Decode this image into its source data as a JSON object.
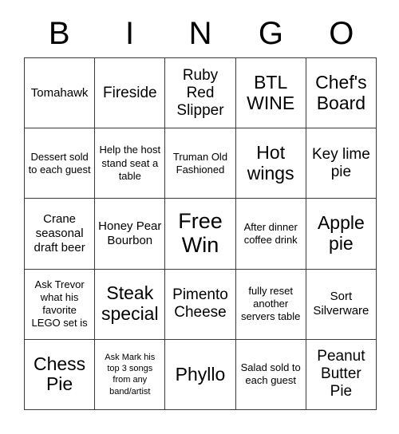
{
  "card": {
    "header_letters": [
      "B",
      "I",
      "N",
      "G",
      "O"
    ],
    "columns": 5,
    "rows": 5,
    "border_color": "#3a3a3a",
    "background_color": "#ffffff",
    "text_color": "#000000",
    "free_space": {
      "row": 2,
      "column": 2,
      "label": "Free Win"
    },
    "cells": [
      {
        "text": "Tomahawk",
        "size": "fs-m"
      },
      {
        "text": "Fireside",
        "size": "fs-l"
      },
      {
        "text": "Ruby Red Slipper",
        "size": "fs-l"
      },
      {
        "text": "BTL WINE",
        "size": "fs-xl"
      },
      {
        "text": "Chef's Board",
        "size": "fs-xl"
      },
      {
        "text": "Dessert sold to each guest",
        "size": "fs-s"
      },
      {
        "text": "Help the host stand seat a table",
        "size": "fs-s"
      },
      {
        "text": "Truman Old Fashioned",
        "size": "fs-s"
      },
      {
        "text": "Hot wings",
        "size": "fs-xl"
      },
      {
        "text": "Key lime pie",
        "size": "fs-l"
      },
      {
        "text": "Crane seasonal draft beer",
        "size": "fs-m"
      },
      {
        "text": "Honey Pear Bourbon",
        "size": "fs-m"
      },
      {
        "text": "Free Win",
        "size": "fs-xxl"
      },
      {
        "text": "After dinner coffee drink",
        "size": "fs-s"
      },
      {
        "text": "Apple pie",
        "size": "fs-xl"
      },
      {
        "text": "Ask Trevor what his favorite LEGO set is",
        "size": "fs-s"
      },
      {
        "text": "Steak special",
        "size": "fs-xl"
      },
      {
        "text": "Pimento Cheese",
        "size": "fs-l"
      },
      {
        "text": "fully reset another servers table",
        "size": "fs-s"
      },
      {
        "text": "Sort Silverware",
        "size": "fs-m"
      },
      {
        "text": "Chess Pie",
        "size": "fs-xl"
      },
      {
        "text": "Ask Mark his top 3 songs from any band/artist",
        "size": "fs-xs"
      },
      {
        "text": "Phyllo",
        "size": "fs-xl"
      },
      {
        "text": "Salad sold to each guest",
        "size": "fs-s"
      },
      {
        "text": "Peanut Butter Pie",
        "size": "fs-l"
      }
    ]
  }
}
